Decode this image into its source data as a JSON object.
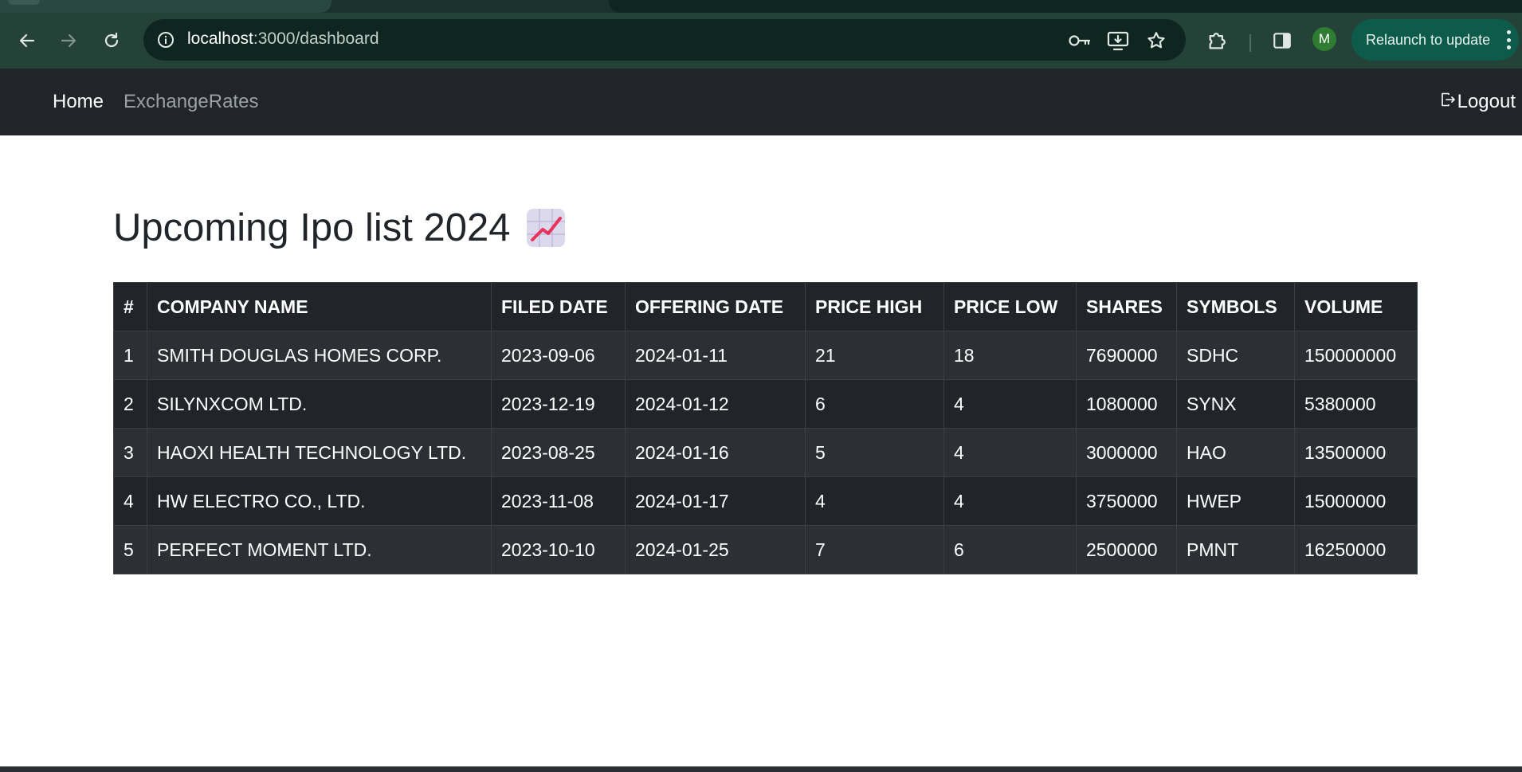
{
  "browser": {
    "url_host": "localhost",
    "url_rest": ":3000/dashboard",
    "profile_initial": "M",
    "relaunch_label": "Relaunch to update"
  },
  "navbar": {
    "home_label": "Home",
    "exchange_rates_label": "ExchangeRates",
    "logout_label": "Logout"
  },
  "page": {
    "title": "Upcoming Ipo list 2024"
  },
  "table": {
    "headers": [
      "#",
      "COMPANY NAME",
      "FILED DATE",
      "OFFERING DATE",
      "PRICE HIGH",
      "PRICE LOW",
      "SHARES",
      "SYMBOLS",
      "VOLUME"
    ],
    "rows": [
      [
        "1",
        "SMITH DOUGLAS HOMES CORP.",
        "2023-09-06",
        "2024-01-11",
        "21",
        "18",
        "7690000",
        "SDHC",
        "150000000"
      ],
      [
        "2",
        "SILYNXCOM LTD.",
        "2023-12-19",
        "2024-01-12",
        "6",
        "4",
        "1080000",
        "SYNX",
        "5380000"
      ],
      [
        "3",
        "HAOXI HEALTH TECHNOLOGY LTD.",
        "2023-08-25",
        "2024-01-16",
        "5",
        "4",
        "3000000",
        "HAO",
        "13500000"
      ],
      [
        "4",
        "HW ELECTRO CO., LTD.",
        "2023-11-08",
        "2024-01-17",
        "4",
        "4",
        "3750000",
        "HWEP",
        "15000000"
      ],
      [
        "5",
        "PERFECT MOMENT LTD.",
        "2023-10-10",
        "2024-01-25",
        "7",
        "6",
        "2500000",
        "PMNT",
        "16250000"
      ]
    ]
  },
  "icons": {
    "back": "arrow-left-icon",
    "forward": "arrow-right-icon",
    "reload": "reload-icon",
    "site_info": "info-icon",
    "password": "key-icon",
    "install": "install-app-icon",
    "bookmark": "star-icon",
    "extensions": "puzzle-icon",
    "side_panel": "side-panel-icon",
    "logout": "logout-icon",
    "title_emoji": "chart-increasing-icon"
  },
  "colors": {
    "navbar_bg": "#212529",
    "table_bg": "#212529",
    "table_stripe": "#2c3034",
    "browser_toolbar": "#254239",
    "relaunch_bg": "#0d5b4a",
    "emoji_line": "#e8335a"
  }
}
